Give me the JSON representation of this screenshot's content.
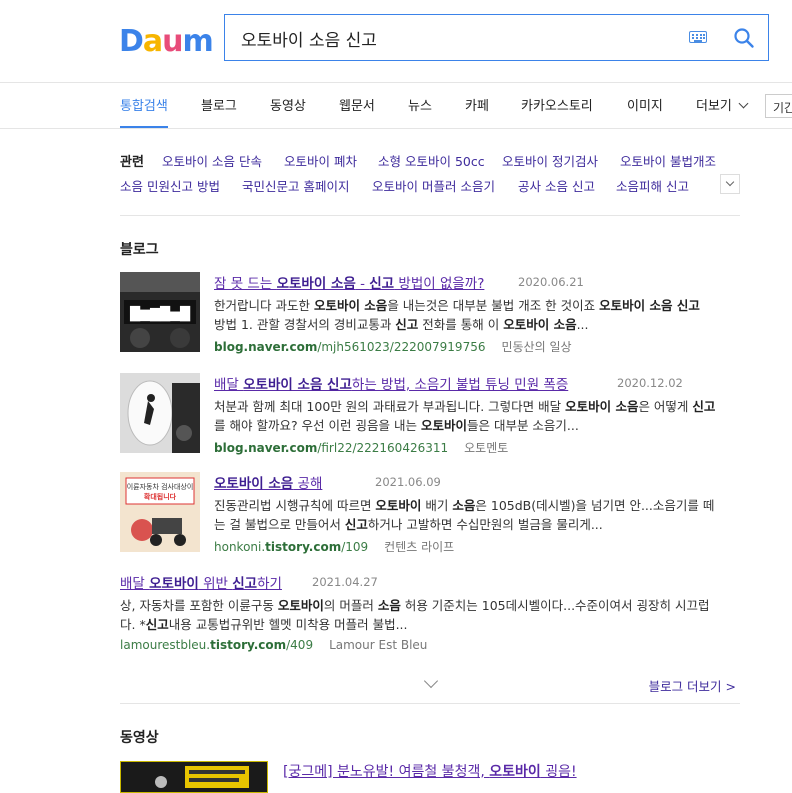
{
  "logo": {
    "text": "Daum",
    "letters": [
      "D",
      "a",
      "u",
      "m"
    ],
    "colors": [
      "#3b83e9",
      "#f7b500",
      "#e84c7a",
      "#3b83e9"
    ]
  },
  "search": {
    "query": "오토바이 소음 신고",
    "keyboard_icon": "keyboard-icon",
    "search_icon": "search-icon"
  },
  "tabs": [
    {
      "label": "통합검색",
      "active": true
    },
    {
      "label": "블로그"
    },
    {
      "label": "동영상"
    },
    {
      "label": "웹문서"
    },
    {
      "label": "뉴스"
    },
    {
      "label": "카페"
    },
    {
      "label": "카카오스토리"
    },
    {
      "label": "이미지"
    },
    {
      "label": "더보기"
    }
  ],
  "period_label": "기간",
  "related": {
    "title": "관련",
    "items": [
      "오토바이 소음 단속",
      "오토바이 폐차",
      "소형 오토바이 50cc",
      "오토바이 정기검사",
      "오토바이 불법개조",
      "소음 민원신고 방법",
      "국민신문고 홈페이지",
      "오토바이 머플러 소음기",
      "공사 소음 신고",
      "소음피해 신고"
    ]
  },
  "blog": {
    "section_title": "블로그",
    "posts": [
      {
        "title_parts": [
          "잠 못 드는 ",
          "오토바이 소음",
          " - ",
          "신고",
          " 방법이 없을까?"
        ],
        "date": "2020.06.21",
        "desc_line1": [
          "한거랍니다 과도한 ",
          "오토바이 소음",
          "을 내는것은 대부분 불법 개조 한 것이죠  ",
          "오토바이 소음 신고"
        ],
        "desc_line2": [
          "방법 1. 관할 경찰서의 경비교통과 ",
          "신고",
          " 전화를 통해 이 ",
          "오토바이 소음",
          "..."
        ],
        "url_parts": [
          "blog.naver.com",
          "/mjh561023/222007919756"
        ],
        "author": "민동산의 일상"
      },
      {
        "title_parts": [
          "배달 ",
          "오토바이 소음 신고",
          "하는 방법, 소음기 불법 튜닝 민원 폭증"
        ],
        "date": "2020.12.02",
        "desc_line1": [
          "처분과 함께 최대 100만 원의 과태료가 부과됩니다.   그렇다면 배달 ",
          "오토바이 소음",
          "은 어떻게 ",
          "신고"
        ],
        "desc_line2": [
          "를 해야 할까요? 우선 이런 굉음을 내는 ",
          "오토바이",
          "들은 대부분 소음기..."
        ],
        "url_parts": [
          "blog.naver.com",
          "/firl22/222160426311"
        ],
        "author": "오토멘토"
      },
      {
        "title_parts": [
          "오토바이 소음",
          " 공해"
        ],
        "date": "2021.06.09",
        "desc_line1": [
          "진동관리법 시행규칙에 따르면 ",
          "오토바이",
          " 배기 ",
          "소음",
          "은 105dB(데시벨)을 넘기면 안...소음기를 떼"
        ],
        "desc_line2": [
          "는 걸 불법으로 만들어서 ",
          "신고",
          "하거나 고발하면 수십만원의 벌금을 물리게..."
        ],
        "url_parts": [
          "honkoni.",
          "tistory.com",
          "/109"
        ],
        "author": "컨텐츠 라이프",
        "thumb_text": [
          "이륜자동차 검사대상이",
          "확대됩니다"
        ]
      },
      {
        "title_parts": [
          "배달 ",
          "오토바이",
          " 위반 ",
          "신고",
          "하기"
        ],
        "date": "2021.04.27",
        "desc_line1": [
          "상, 자동차를 포함한 이륜구동 ",
          "오토바이",
          "의 머플러 ",
          "소음",
          " 허용 기준치는 105데시벨이다...수준이여서 굉장히 시끄럽"
        ],
        "desc_line2": [
          "다. *",
          "신고",
          "내용 교통법규위반 헬멧 미착용 머플러 불법..."
        ],
        "url_parts": [
          "lamourestbleu.",
          "tistory.com",
          "/409"
        ],
        "author": "Lamour Est Bleu"
      }
    ],
    "more_label": "블로그 더보기 >"
  },
  "video": {
    "section_title": "동영상",
    "title_parts": [
      "[궁그메] 분노유발! 여름철 불청객, ",
      "오토바이",
      " 굉음!"
    ]
  }
}
